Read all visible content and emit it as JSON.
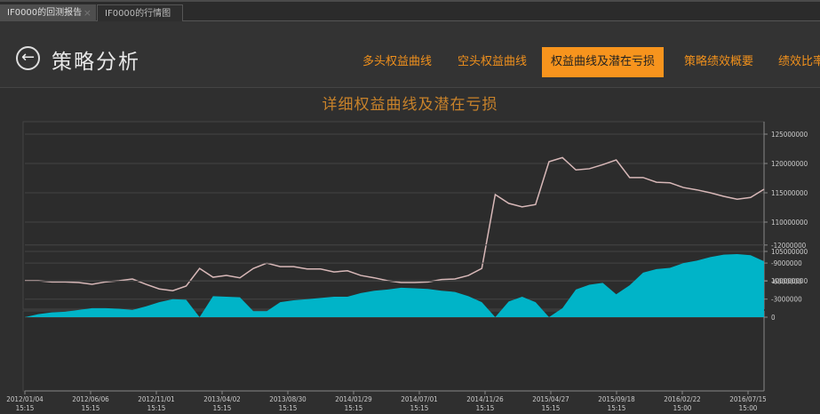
{
  "tabs": [
    {
      "label": "IF0000的回测报告",
      "close": "×"
    },
    {
      "label": "IF0000的行情图"
    }
  ],
  "header": {
    "back_icon": "arrow-left-circle-icon",
    "title": "策略分析"
  },
  "nav": [
    {
      "label": "多头权益曲线"
    },
    {
      "label": "空头权益曲线"
    },
    {
      "label": "权益曲线及潜在亏损",
      "active": true
    },
    {
      "label": "策略绩效概要"
    },
    {
      "label": "绩效比率"
    }
  ],
  "colors": {
    "accent": "#f7941d",
    "equity_line": "#d8b8b8",
    "drawdown_fill": "#00b4c8"
  },
  "chart_data": [
    {
      "type": "line",
      "title": "详细权益曲线及潜在亏损",
      "ylim": [
        95000000,
        127500000
      ],
      "yticks": [
        "125000000",
        "120000000",
        "115000000",
        "110000000",
        "105000000",
        "100000000"
      ],
      "x": [
        "2012-01",
        "2012-02",
        "2012-03",
        "2012-04",
        "2012-05",
        "2012-06",
        "2012-07",
        "2012-08",
        "2012-09",
        "2012-10",
        "2012-11",
        "2012-12",
        "2013-01",
        "2013-02",
        "2013-03",
        "2013-04",
        "2013-05",
        "2013-06",
        "2013-07",
        "2013-08",
        "2013-09",
        "2013-10",
        "2013-11",
        "2013-12",
        "2014-01",
        "2014-02",
        "2014-03",
        "2014-04",
        "2014-05",
        "2014-06",
        "2014-07",
        "2014-08",
        "2014-09",
        "2014-10",
        "2014-11",
        "2014-12",
        "2015-01",
        "2015-02",
        "2015-03",
        "2015-04",
        "2015-05",
        "2015-06",
        "2015-07",
        "2015-08",
        "2015-09",
        "2015-10",
        "2015-11",
        "2015-12",
        "2016-01",
        "2016-02",
        "2016-03",
        "2016-04",
        "2016-05",
        "2016-06",
        "2016-07",
        "2016-07"
      ],
      "values": [
        100000000,
        100000000,
        99800000,
        99800000,
        99700000,
        99400000,
        99800000,
        100000000,
        100300000,
        99400000,
        98600000,
        98300000,
        99100000,
        102100000,
        100600000,
        100900000,
        100500000,
        102100000,
        103000000,
        102400000,
        102400000,
        102000000,
        102000000,
        101500000,
        101700000,
        100900000,
        100500000,
        100000000,
        99700000,
        99700000,
        99800000,
        100200000,
        100300000,
        100900000,
        102100000,
        114700000,
        113200000,
        112600000,
        113000000,
        120300000,
        121000000,
        118900000,
        119100000,
        119800000,
        120600000,
        117600000,
        117600000,
        116800000,
        116700000,
        115900000,
        115500000,
        115000000,
        114400000,
        113900000,
        114200000,
        115600000
      ]
    },
    {
      "type": "area",
      "ylim": [
        -12000000,
        0
      ],
      "yticks": [
        "0",
        "-3000000",
        "-6000000",
        "-9000000",
        "-12000000"
      ],
      "values": [
        0,
        -500000,
        -800000,
        -900000,
        -1200000,
        -1500000,
        -1500000,
        -1400000,
        -1200000,
        -1800000,
        -2500000,
        -3000000,
        -2900000,
        0,
        -3500000,
        -3400000,
        -3300000,
        -1000000,
        -1000000,
        -2500000,
        -2800000,
        -3000000,
        -3200000,
        -3400000,
        -3400000,
        -4000000,
        -4400000,
        -4600000,
        -4900000,
        -4800000,
        -4700000,
        -4400000,
        -4200000,
        -3500000,
        -2500000,
        0,
        -2600000,
        -3400000,
        -2500000,
        0,
        -1500000,
        -4600000,
        -5400000,
        -5700000,
        -3800000,
        -5300000,
        -7400000,
        -8000000,
        -8200000,
        -9000000,
        -9400000,
        -10000000,
        -10400000,
        -10500000,
        -10300000,
        -9300000
      ]
    }
  ],
  "xticks": [
    [
      "2012/01/04",
      "15:15"
    ],
    [
      "2012/06/06",
      "15:15"
    ],
    [
      "2012/11/01",
      "15:15"
    ],
    [
      "2013/04/02",
      "15:15"
    ],
    [
      "2013/08/30",
      "15:15"
    ],
    [
      "2014/01/29",
      "15:15"
    ],
    [
      "2014/07/01",
      "15:15"
    ],
    [
      "2014/11/26",
      "15:15"
    ],
    [
      "2015/04/27",
      "15:15"
    ],
    [
      "2015/09/18",
      "15:15"
    ],
    [
      "2016/02/22",
      "15:00"
    ],
    [
      "2016/07/15",
      "15:00"
    ]
  ]
}
